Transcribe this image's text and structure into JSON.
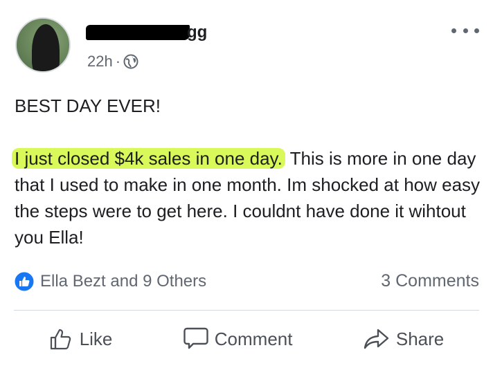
{
  "post": {
    "author_visible_suffix": "gg",
    "time": "22h",
    "separator": "·",
    "headline": "BEST DAY EVER!",
    "highlighted_text": "I just closed $4k sales in one day.",
    "body_rest": " This is more in one day that I used to make in one month. Im shocked at how easy the steps were to get here. I couldnt have done it wihtout you Ella!",
    "privacy_icon": "globe-icon",
    "highlight_color": "#d9f85a"
  },
  "stats": {
    "reactions_text": "Ella Bezt and 9 Others",
    "comments_text": "3 Comments",
    "like_badge_color": "#1877f2"
  },
  "actions": {
    "like_label": "Like",
    "comment_label": "Comment",
    "share_label": "Share"
  }
}
